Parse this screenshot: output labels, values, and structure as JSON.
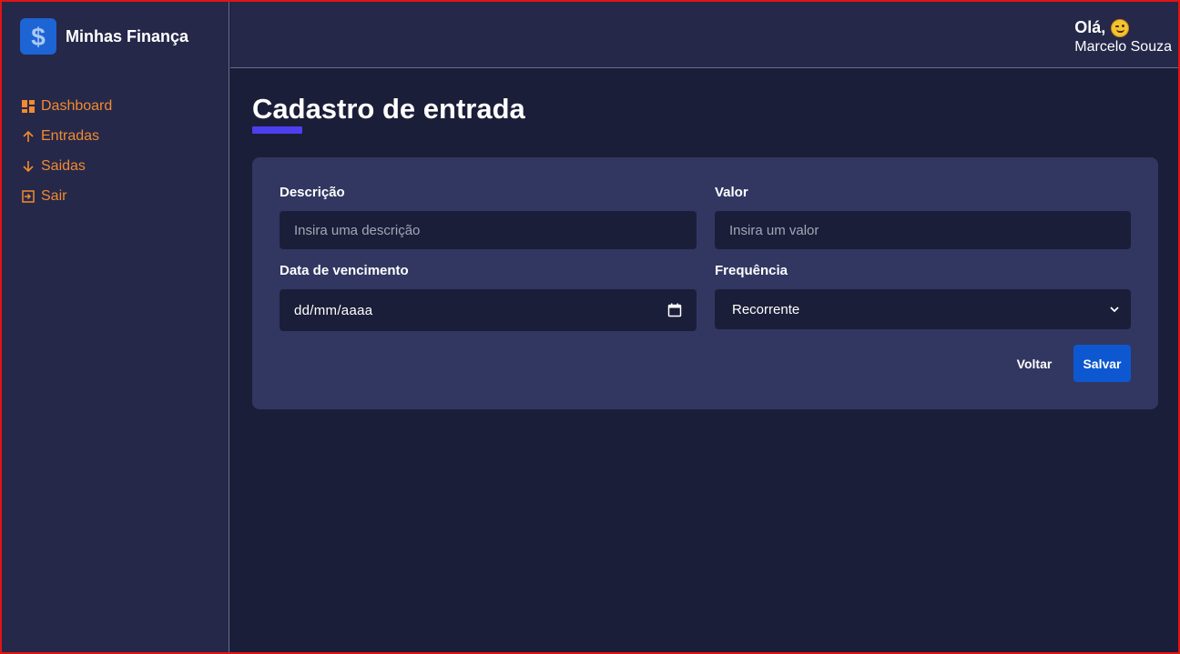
{
  "app": {
    "title": "Minhas Finança"
  },
  "sidebar": {
    "items": [
      {
        "label": "Dashboard",
        "icon": "dashboard-icon"
      },
      {
        "label": "Entradas",
        "icon": "arrow-up-icon"
      },
      {
        "label": "Saidas",
        "icon": "arrow-down-icon"
      },
      {
        "label": "Sair",
        "icon": "logout-icon"
      }
    ]
  },
  "header": {
    "greeting": "Olá,",
    "emoji": "smirk-emoji-icon",
    "username": "Marcelo Souza"
  },
  "main": {
    "title": "Cadastro de entrada",
    "form": {
      "description": {
        "label": "Descrição",
        "placeholder": "Insira uma descrição",
        "value": ""
      },
      "amount": {
        "label": "Valor",
        "placeholder": "Insira um valor",
        "value": ""
      },
      "due_date": {
        "label": "Data de vencimento",
        "value": "dd/mm/aaaa",
        "icon": "calendar-icon"
      },
      "frequency": {
        "label": "Frequência",
        "selected": "Recorrente",
        "icon": "chevron-down-icon"
      },
      "back_label": "Voltar",
      "save_label": "Salvar"
    }
  },
  "colors": {
    "background": "#1b1e38",
    "sidebar": "#252849",
    "card": "#313761",
    "accent_orange": "#f28a30",
    "accent_purple": "#4d3ef0",
    "primary_button": "#0d58d0",
    "frame": "#e01414"
  }
}
